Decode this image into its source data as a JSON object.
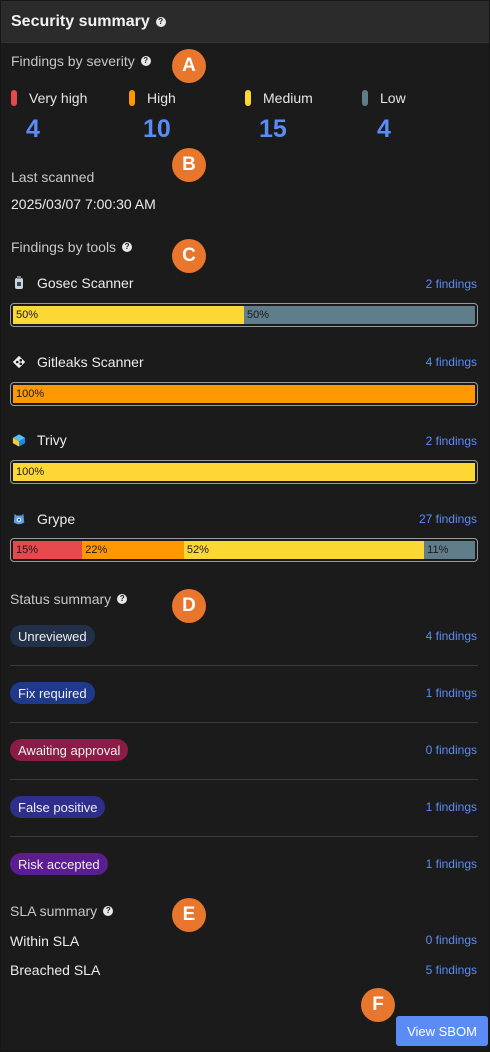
{
  "header": {
    "title": "Security summary"
  },
  "markers": [
    "A",
    "B",
    "C",
    "D",
    "E",
    "F"
  ],
  "severity": {
    "title": "Findings by severity",
    "items": [
      {
        "label": "Very high",
        "count": "4",
        "color": "#e5484d"
      },
      {
        "label": "High",
        "count": "10",
        "color": "#ff9800"
      },
      {
        "label": "Medium",
        "count": "15",
        "color": "#fdd835"
      },
      {
        "label": "Low",
        "count": "4",
        "color": "#607d8b"
      }
    ]
  },
  "scan": {
    "label": "Last scanned",
    "value": "2025/03/07 7:00:30 AM"
  },
  "tools": {
    "title": "Findings by tools",
    "items": [
      {
        "name": "Gosec Scanner",
        "icon": "gosec-icon",
        "findings": "2 findings",
        "segments": [
          {
            "label": "50%",
            "fraction": 0.5,
            "color": "#fdd835"
          },
          {
            "label": "50%",
            "fraction": 0.5,
            "color": "#607d8b"
          }
        ]
      },
      {
        "name": "Gitleaks Scanner",
        "icon": "gitleaks-icon",
        "findings": "4 findings",
        "segments": [
          {
            "label": "100%",
            "fraction": 1.0,
            "color": "#ff9800"
          }
        ]
      },
      {
        "name": "Trivy",
        "icon": "trivy-icon",
        "findings": "2 findings",
        "segments": [
          {
            "label": "100%",
            "fraction": 1.0,
            "color": "#fdd835"
          }
        ]
      },
      {
        "name": "Grype",
        "icon": "grype-icon",
        "findings": "27 findings",
        "segments": [
          {
            "label": "15%",
            "fraction": 0.15,
            "color": "#e5484d"
          },
          {
            "label": "22%",
            "fraction": 0.22,
            "color": "#ff9800"
          },
          {
            "label": "52%",
            "fraction": 0.52,
            "color": "#fdd835"
          },
          {
            "label": "11%",
            "fraction": 0.11,
            "color": "#607d8b"
          }
        ]
      }
    ]
  },
  "status": {
    "title": "Status summary",
    "items": [
      {
        "label": "Unreviewed",
        "findings": "4 findings",
        "color": "#22304a"
      },
      {
        "label": "Fix required",
        "findings": "1 findings",
        "color": "#1f3a8a"
      },
      {
        "label": "Awaiting approval",
        "findings": "0 findings",
        "color": "#8a1c47"
      },
      {
        "label": "False positive",
        "findings": "1 findings",
        "color": "#2e2f8a"
      },
      {
        "label": "Risk accepted",
        "findings": "1 findings",
        "color": "#5b1d8f"
      }
    ]
  },
  "sla": {
    "title": "SLA summary",
    "items": [
      {
        "label": "Within SLA",
        "findings": "0 findings"
      },
      {
        "label": "Breached SLA",
        "findings": "5 findings"
      }
    ]
  },
  "actions": {
    "view_sbom": "View SBOM"
  }
}
